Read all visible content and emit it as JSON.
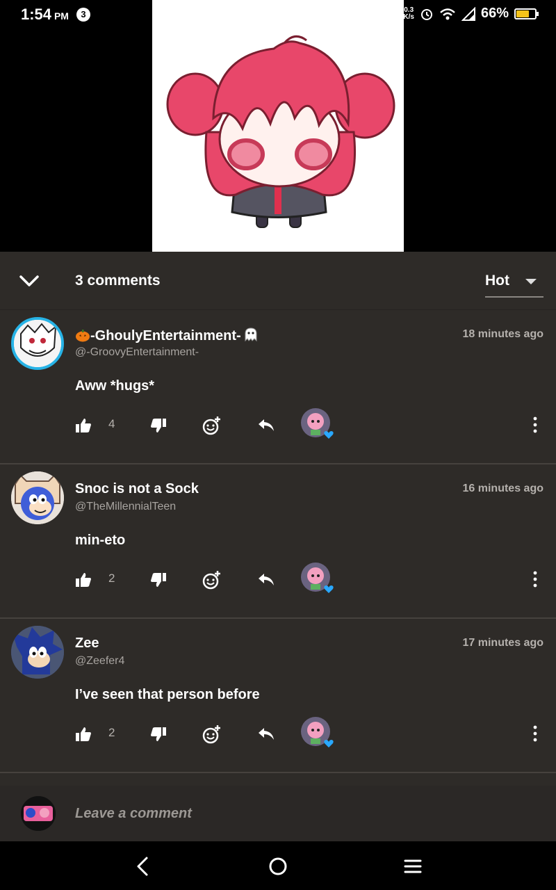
{
  "status_bar": {
    "time": "1:54",
    "ampm": "PM",
    "notification_count": "3",
    "net_speed_top": "0.3",
    "net_speed_bottom": "K/s",
    "battery": "66%",
    "battery_color": "#f5c31a",
    "icons": [
      "alarm-icon",
      "wifi-icon",
      "signal-icon",
      "battery-icon"
    ]
  },
  "post_image": {
    "subject": "chibi character with pink twin-tail hair"
  },
  "comments_header": {
    "count_label": "3 comments",
    "sort_value": "Hot"
  },
  "comments": [
    {
      "author": "-GhoulyEntertainment-",
      "author_prefix_icon": "pumpkin-icon",
      "author_suffix_icon": "ghost-icon",
      "handle": "@-GroovyEntertainment-",
      "time": "18 minutes ago",
      "text": "Aww *hugs*",
      "likes": "4"
    },
    {
      "author": "Snoc is not a Sock",
      "handle": "@TheMillennialTeen",
      "time": "16 minutes ago",
      "text": "min-eto",
      "likes": "2"
    },
    {
      "author": "Zee",
      "handle": "@Zeefer4",
      "time": "17 minutes ago",
      "text": "I’ve seen that person before",
      "likes": "2"
    }
  ],
  "compose": {
    "placeholder": "Leave a comment"
  },
  "colors": {
    "sheet_bg": "#2e2b28",
    "accent_heart": "#29a8ff",
    "hair_pink": "#e8476a"
  }
}
